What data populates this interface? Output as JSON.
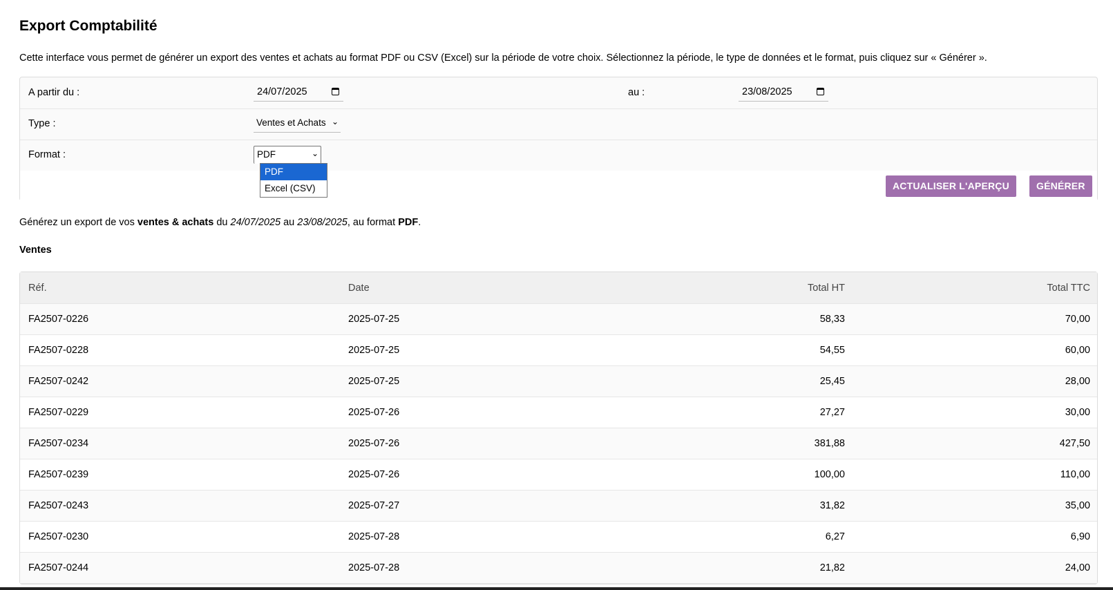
{
  "page": {
    "title": "Export Comptabilité",
    "intro": "Cette interface vous permet de générer un export des ventes et achats au format PDF ou CSV (Excel) sur la période de votre choix. Sélectionnez la période, le type de données et le format, puis cliquez sur « Générer »."
  },
  "form": {
    "from_label": "A partir du :",
    "from_value": "24/07/2025",
    "to_label": "au :",
    "to_value": "23/08/2025",
    "type_label": "Type :",
    "type_value": "Ventes et Achats",
    "format_label": "Format :",
    "format_value": "PDF",
    "format_options": [
      "PDF",
      "Excel (CSV)"
    ],
    "format_selected_index": 0,
    "refresh_button": "ACTUALISER L'APERÇU",
    "generate_button": "GÉNÉRER"
  },
  "summary": {
    "prefix": "Générez un export de vos ",
    "type_bold": "ventes & achats",
    "mid1": " du ",
    "from_italic": "24/07/2025",
    "mid2": " au ",
    "to_italic": "23/08/2025",
    "mid3": ", au format ",
    "format_bold": "PDF",
    "suffix": "."
  },
  "sales": {
    "heading": "Ventes",
    "columns": [
      "Réf.",
      "Date",
      "Total HT",
      "Total TTC"
    ],
    "rows": [
      [
        "FA2507-0226",
        "2025-07-25",
        "58,33",
        "70,00"
      ],
      [
        "FA2507-0228",
        "2025-07-25",
        "54,55",
        "60,00"
      ],
      [
        "FA2507-0242",
        "2025-07-25",
        "25,45",
        "28,00"
      ],
      [
        "FA2507-0229",
        "2025-07-26",
        "27,27",
        "30,00"
      ],
      [
        "FA2507-0234",
        "2025-07-26",
        "381,88",
        "427,50"
      ],
      [
        "FA2507-0239",
        "2025-07-26",
        "100,00",
        "110,00"
      ],
      [
        "FA2507-0243",
        "2025-07-27",
        "31,82",
        "35,00"
      ],
      [
        "FA2507-0230",
        "2025-07-28",
        "6,27",
        "6,90"
      ],
      [
        "FA2507-0244",
        "2025-07-28",
        "21,82",
        "24,00"
      ]
    ]
  },
  "colors": {
    "button": "#a06fad",
    "dropdown_selected": "#1a67d2"
  },
  "icons": {
    "date_picker": "calendar-icon",
    "select_arrow": "chevron-down-icon"
  }
}
